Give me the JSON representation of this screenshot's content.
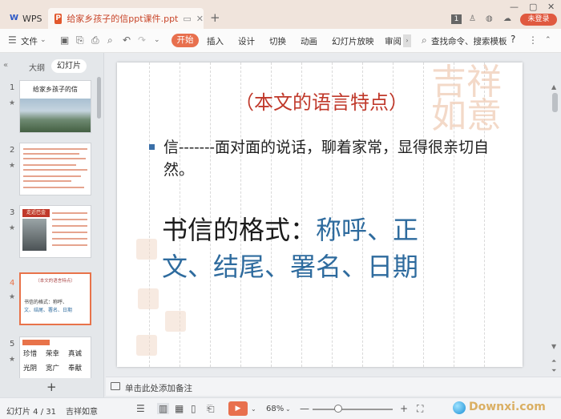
{
  "app": {
    "home_tab": "WPS",
    "doc_tab": "给家乡孩子的信ppt课件.ppt",
    "login_button": "未登录",
    "page_badge": "1"
  },
  "ribbon": {
    "file_menu": "文件",
    "tabs": [
      "开始",
      "插入",
      "设计",
      "切换",
      "动画",
      "幻灯片放映",
      "审阅"
    ],
    "search": "查找命令、搜索模板",
    "help": "?"
  },
  "left_panel": {
    "tabs": [
      "大纲",
      "幻灯片"
    ],
    "active_tab": "幻灯片",
    "thumbnails": [
      {
        "num": "1",
        "title": "给家乡孩子的信"
      },
      {
        "num": "2"
      },
      {
        "num": "3",
        "red_label": "走近巴金"
      },
      {
        "num": "4",
        "header": "（本文的语言特点）",
        "line1": "书信的格式：称呼、",
        "line2": "文、结尾、署名、日期"
      },
      {
        "num": "5",
        "rows": [
          [
            "珍惜",
            "荣幸",
            "真诚"
          ],
          [
            "光阴",
            "宽广",
            "奉献"
          ]
        ]
      }
    ],
    "add_slide": "+"
  },
  "slide": {
    "title": "（本文的语言特点）",
    "bullet": "信-------面对面的说话，聊着家常，显得很亲切自然。",
    "big_prefix": "书信的格式：",
    "big_blue_1": "称呼、正",
    "big_blue_2": "文、结尾、署名、日期",
    "seal_text": "吉祥如意"
  },
  "notes": {
    "placeholder": "单击此处添加备注"
  },
  "status": {
    "slide_counter": "幻灯片 4 / 31",
    "theme": "吉祥如意",
    "zoom": "68%",
    "zoom_level": 0.68,
    "watermark": "Downxi.com"
  }
}
